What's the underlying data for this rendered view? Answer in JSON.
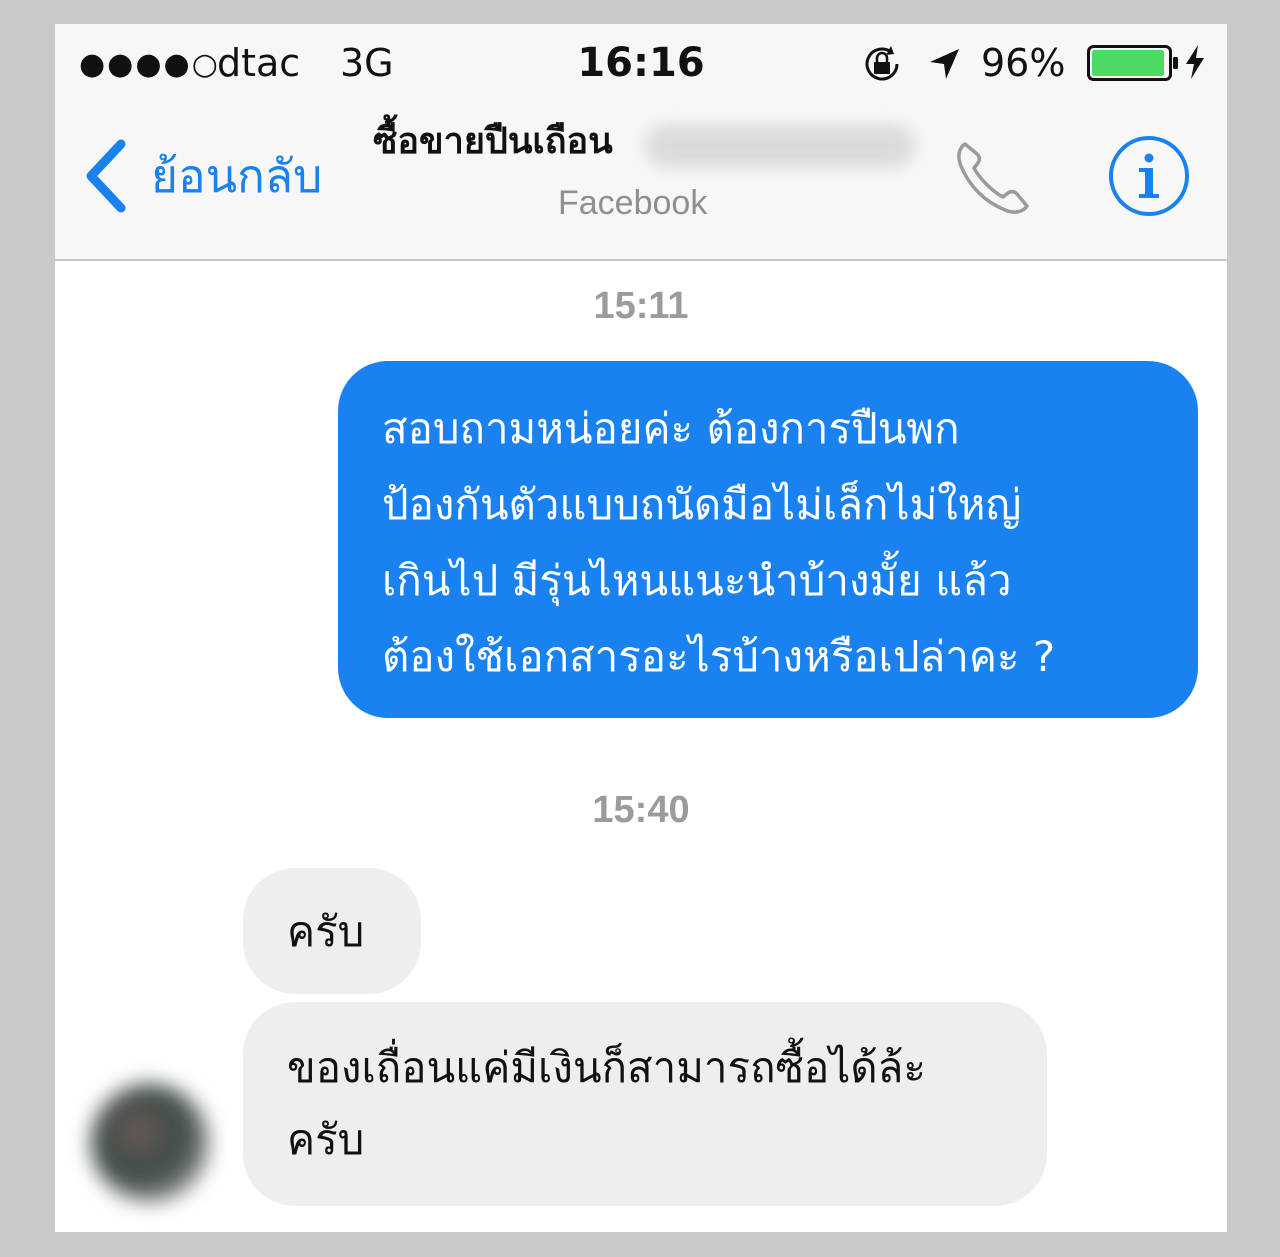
{
  "status_bar": {
    "signal": "●●●●○",
    "carrier": "dtac",
    "network": "3G",
    "time": "16:16",
    "battery_percent": "96%",
    "battery_level": 0.96,
    "icons": [
      "rotation-lock-icon",
      "location-arrow-icon",
      "battery-icon",
      "charging-bolt-icon"
    ]
  },
  "nav": {
    "back_label": "ย้อนกลับ",
    "title": "ซื้อขายปืนเถือน",
    "subtitle": "Facebook",
    "icons": [
      "back-chevron-icon",
      "phone-icon",
      "info-icon"
    ]
  },
  "colors": {
    "accent": "#1a82f0",
    "outgoing_bubble": "#1a82f0",
    "incoming_bubble": "#eeeeee",
    "battery_fill": "#4cd964",
    "timestamp": "#9b9b9b"
  },
  "messages": [
    {
      "timestamp": "15:11",
      "direction": "outgoing",
      "lines": [
        "สอบถามหน่อยค่ะ ต้องการปืนพก",
        "ป้องกันตัวแบบถนัดมือไม่เล็กไม่ใหญ่",
        "เกินไป มีรุ่นไหนแนะนำบ้างมั้ย แล้ว",
        "ต้องใช้เอกสารอะไรบ้างหรือเปล่าคะ ?"
      ]
    },
    {
      "timestamp": "15:40",
      "direction": "incoming",
      "lines": [
        "ครับ"
      ]
    },
    {
      "direction": "incoming",
      "lines": [
        "ของเถื่อนแค่มีเงินก็สามารถซื้อได้ล้ะ",
        "ครับ"
      ]
    }
  ]
}
